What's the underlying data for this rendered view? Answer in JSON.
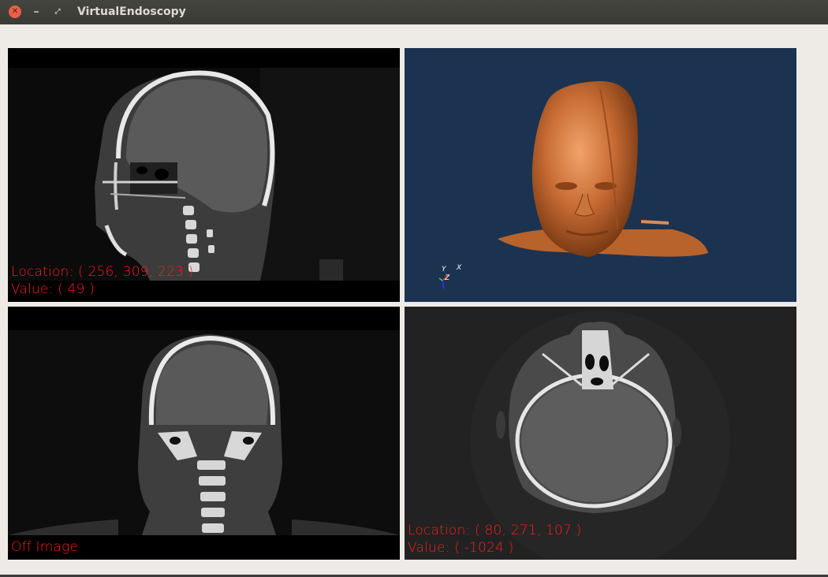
{
  "window": {
    "title": "VirtualEndoscopy",
    "close_glyph": "✕",
    "minimize_glyph": "–",
    "restore_glyph": "⤢"
  },
  "viewports": {
    "sagittal": {
      "location": "Location: ( 256, 309, 223 )",
      "value": "Value: ( 49 )",
      "text_color": "#ff1c1c"
    },
    "volume_3d": {
      "background": "#1b3350",
      "axis_labels": {
        "y": "Y",
        "x": "X",
        "z": "Z"
      }
    },
    "coronal": {
      "status": "Off Image"
    },
    "axial": {
      "location": "Location: ( 80, 271, 107 )",
      "value": "Value: ( -1024 )"
    }
  }
}
